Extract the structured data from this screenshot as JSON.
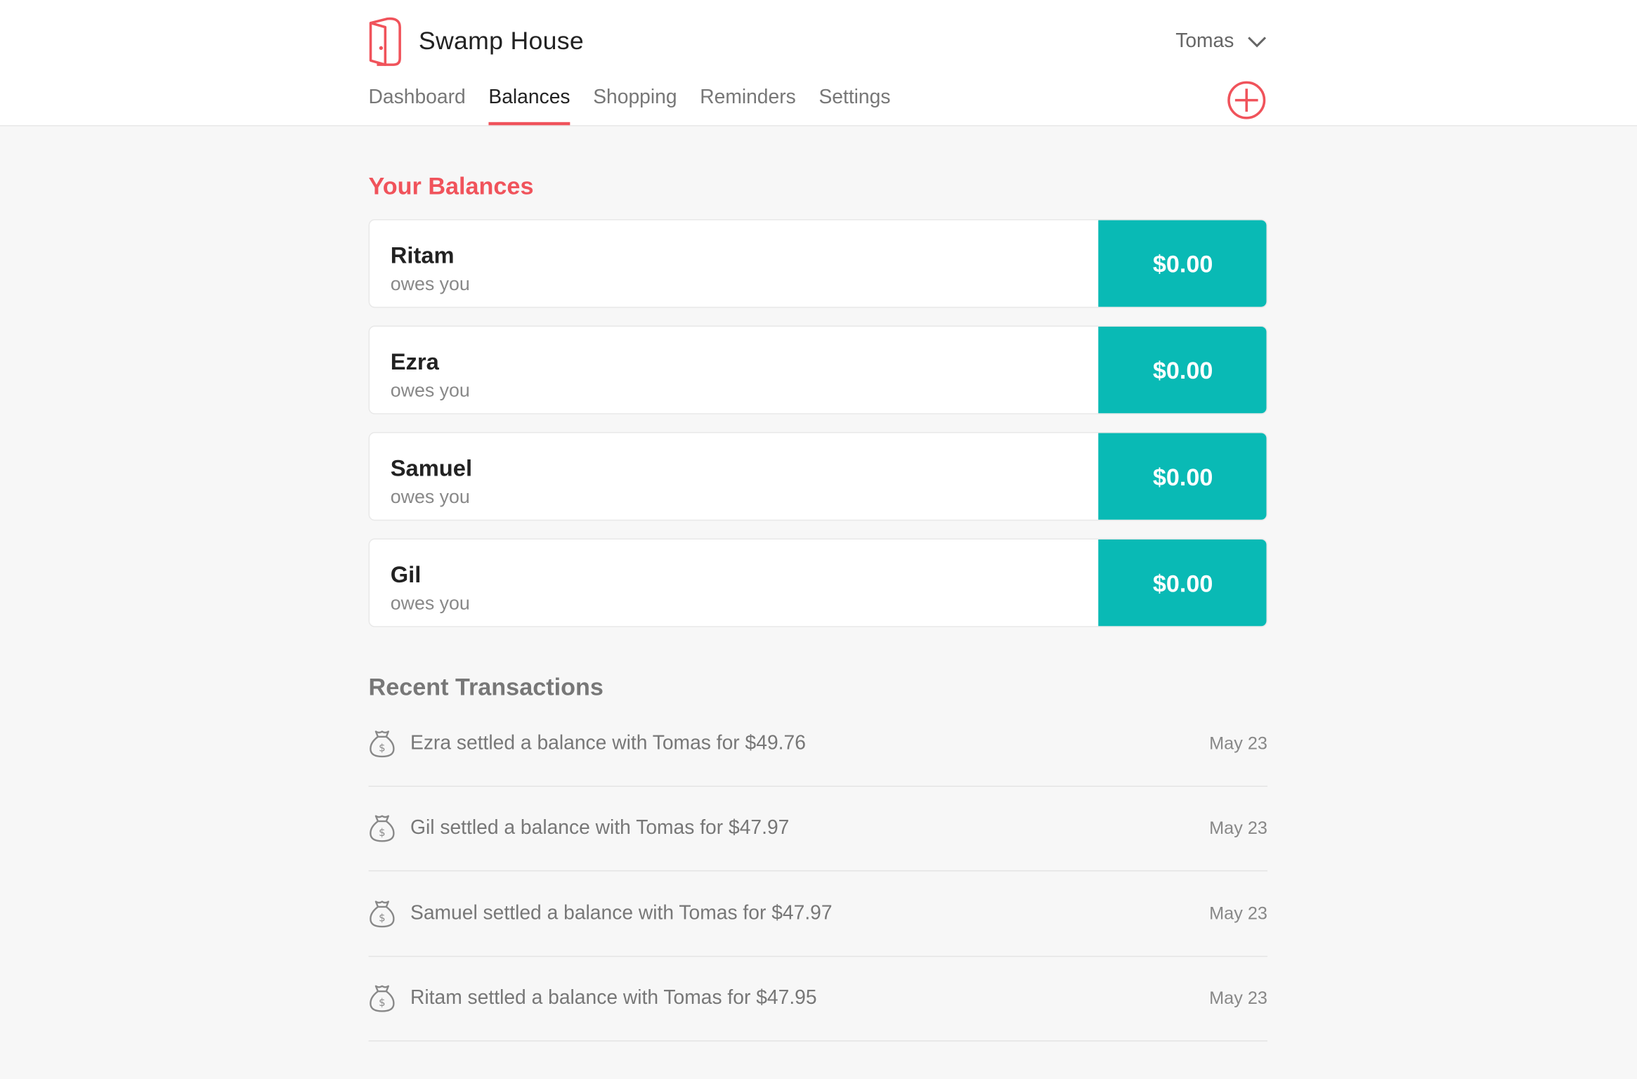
{
  "app": {
    "title": "Swamp House",
    "brand_color": "#f0535b",
    "accent_color": "#09bab5",
    "logo_icon": "door-icon"
  },
  "user": {
    "name": "Tomas"
  },
  "nav": {
    "tabs": [
      {
        "label": "Dashboard",
        "active": false
      },
      {
        "label": "Balances",
        "active": true
      },
      {
        "label": "Shopping",
        "active": false
      },
      {
        "label": "Reminders",
        "active": false
      },
      {
        "label": "Settings",
        "active": false
      }
    ],
    "add_icon": "plus-circle-icon"
  },
  "balances": {
    "title": "Your Balances",
    "items": [
      {
        "name": "Ritam",
        "status": "owes you",
        "amount": "$0.00"
      },
      {
        "name": "Ezra",
        "status": "owes you",
        "amount": "$0.00"
      },
      {
        "name": "Samuel",
        "status": "owes you",
        "amount": "$0.00"
      },
      {
        "name": "Gil",
        "status": "owes you",
        "amount": "$0.00"
      }
    ]
  },
  "transactions": {
    "title": "Recent Transactions",
    "icon": "money-bag-icon",
    "items": [
      {
        "text": "Ezra settled a balance with Tomas for $49.76",
        "date": "May 23"
      },
      {
        "text": "Gil settled a balance with Tomas for $47.97",
        "date": "May 23"
      },
      {
        "text": "Samuel settled a balance with Tomas for $47.97",
        "date": "May 23"
      },
      {
        "text": "Ritam settled a balance with Tomas for $47.95",
        "date": "May 23"
      }
    ]
  }
}
